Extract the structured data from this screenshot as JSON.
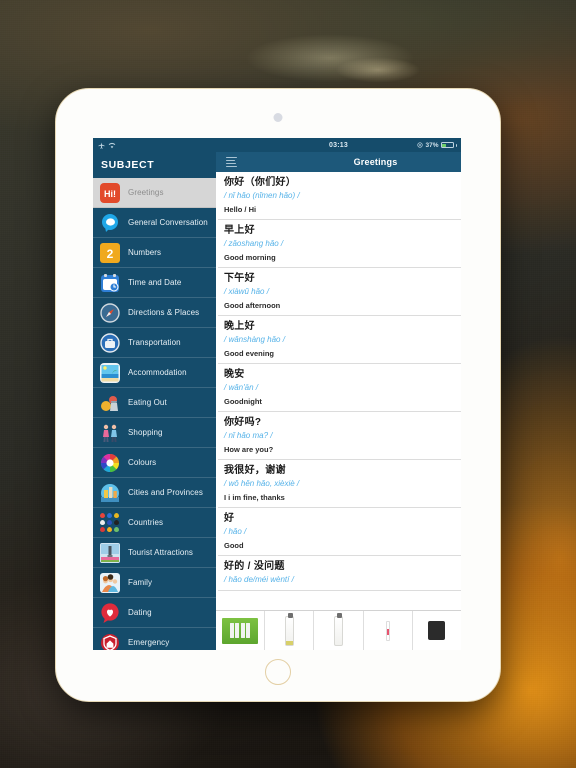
{
  "status_bar": {
    "time": "03:13",
    "battery_percent": "37%",
    "icons": [
      "airplane-icon",
      "wifi-icon",
      "location-icon"
    ]
  },
  "sidebar": {
    "header": "SUBJECT",
    "items": [
      {
        "label": "Greetings",
        "icon": "hi-badge-icon",
        "active": true
      },
      {
        "label": "General Conversation",
        "icon": "speech-bubble-icon",
        "active": false
      },
      {
        "label": "Numbers",
        "icon": "number-two-icon",
        "active": false
      },
      {
        "label": "Time and Date",
        "icon": "calendar-clock-icon",
        "active": false
      },
      {
        "label": "Directions & Places",
        "icon": "compass-icon",
        "active": false
      },
      {
        "label": "Transportation",
        "icon": "suitcase-icon",
        "active": false
      },
      {
        "label": "Accommodation",
        "icon": "beach-resort-icon",
        "active": false
      },
      {
        "label": "Eating Out",
        "icon": "food-drink-icon",
        "active": false
      },
      {
        "label": "Shopping",
        "icon": "shoppers-icon",
        "active": false
      },
      {
        "label": "Colours",
        "icon": "color-wheel-icon",
        "active": false
      },
      {
        "label": "Cities and Provinces",
        "icon": "cityscape-icon",
        "active": false
      },
      {
        "label": "Countries",
        "icon": "flag-pins-icon",
        "active": false
      },
      {
        "label": "Tourist Attractions",
        "icon": "monument-icon",
        "active": false
      },
      {
        "label": "Family",
        "icon": "family-icon",
        "active": false
      },
      {
        "label": "Dating",
        "icon": "heart-bubble-icon",
        "active": false
      },
      {
        "label": "Emergency",
        "icon": "emergency-shield-icon",
        "active": false
      }
    ]
  },
  "navbar": {
    "menu_icon": "hamburger-menu-icon",
    "title": "Greetings"
  },
  "phrases": [
    {
      "hanzi": "你好（你们好）",
      "pinyin": "/ nǐ hǎo (nǐmen hǎo) /",
      "english": "Hello / Hi"
    },
    {
      "hanzi": "早上好",
      "pinyin": "/ zǎoshang hǎo /",
      "english": "Good morning"
    },
    {
      "hanzi": "下午好",
      "pinyin": "/ xiàwǔ hǎo /",
      "english": "Good afternoon"
    },
    {
      "hanzi": "晚上好",
      "pinyin": "/ wǎnshàng hǎo /",
      "english": "Good evening"
    },
    {
      "hanzi": "晚安",
      "pinyin": "/ wǎn'ān /",
      "english": "Goodnight"
    },
    {
      "hanzi": "你好吗?",
      "pinyin": "/ nǐ hǎo ma? /",
      "english": "How are you?"
    },
    {
      "hanzi": "我很好，谢谢",
      "pinyin": "/ wǒ hěn hǎo, xièxiè /",
      "english": "I i im fine, thanks"
    },
    {
      "hanzi": "好",
      "pinyin": "/ hǎo /",
      "english": "Good"
    },
    {
      "hanzi": "好的 / 没问题",
      "pinyin": "/ hǎo de/méi wèntí /",
      "english": ""
    }
  ],
  "ad_bar": {
    "items": [
      {
        "name": "green-product-box"
      },
      {
        "name": "white-pump-bottle"
      },
      {
        "name": "white-spray-bottle"
      },
      {
        "name": "pink-lip-tube"
      },
      {
        "name": "black-compact-case"
      }
    ]
  },
  "device": {
    "camera": "front-camera-dot",
    "home_button": "home-button"
  },
  "colors": {
    "sidebar_bg": "#154c6b",
    "navbar_bg": "#1d587a",
    "pinyin": "#55b2e8",
    "active_row": "#d6d6d6",
    "battery_fill": "#6ed06b"
  }
}
